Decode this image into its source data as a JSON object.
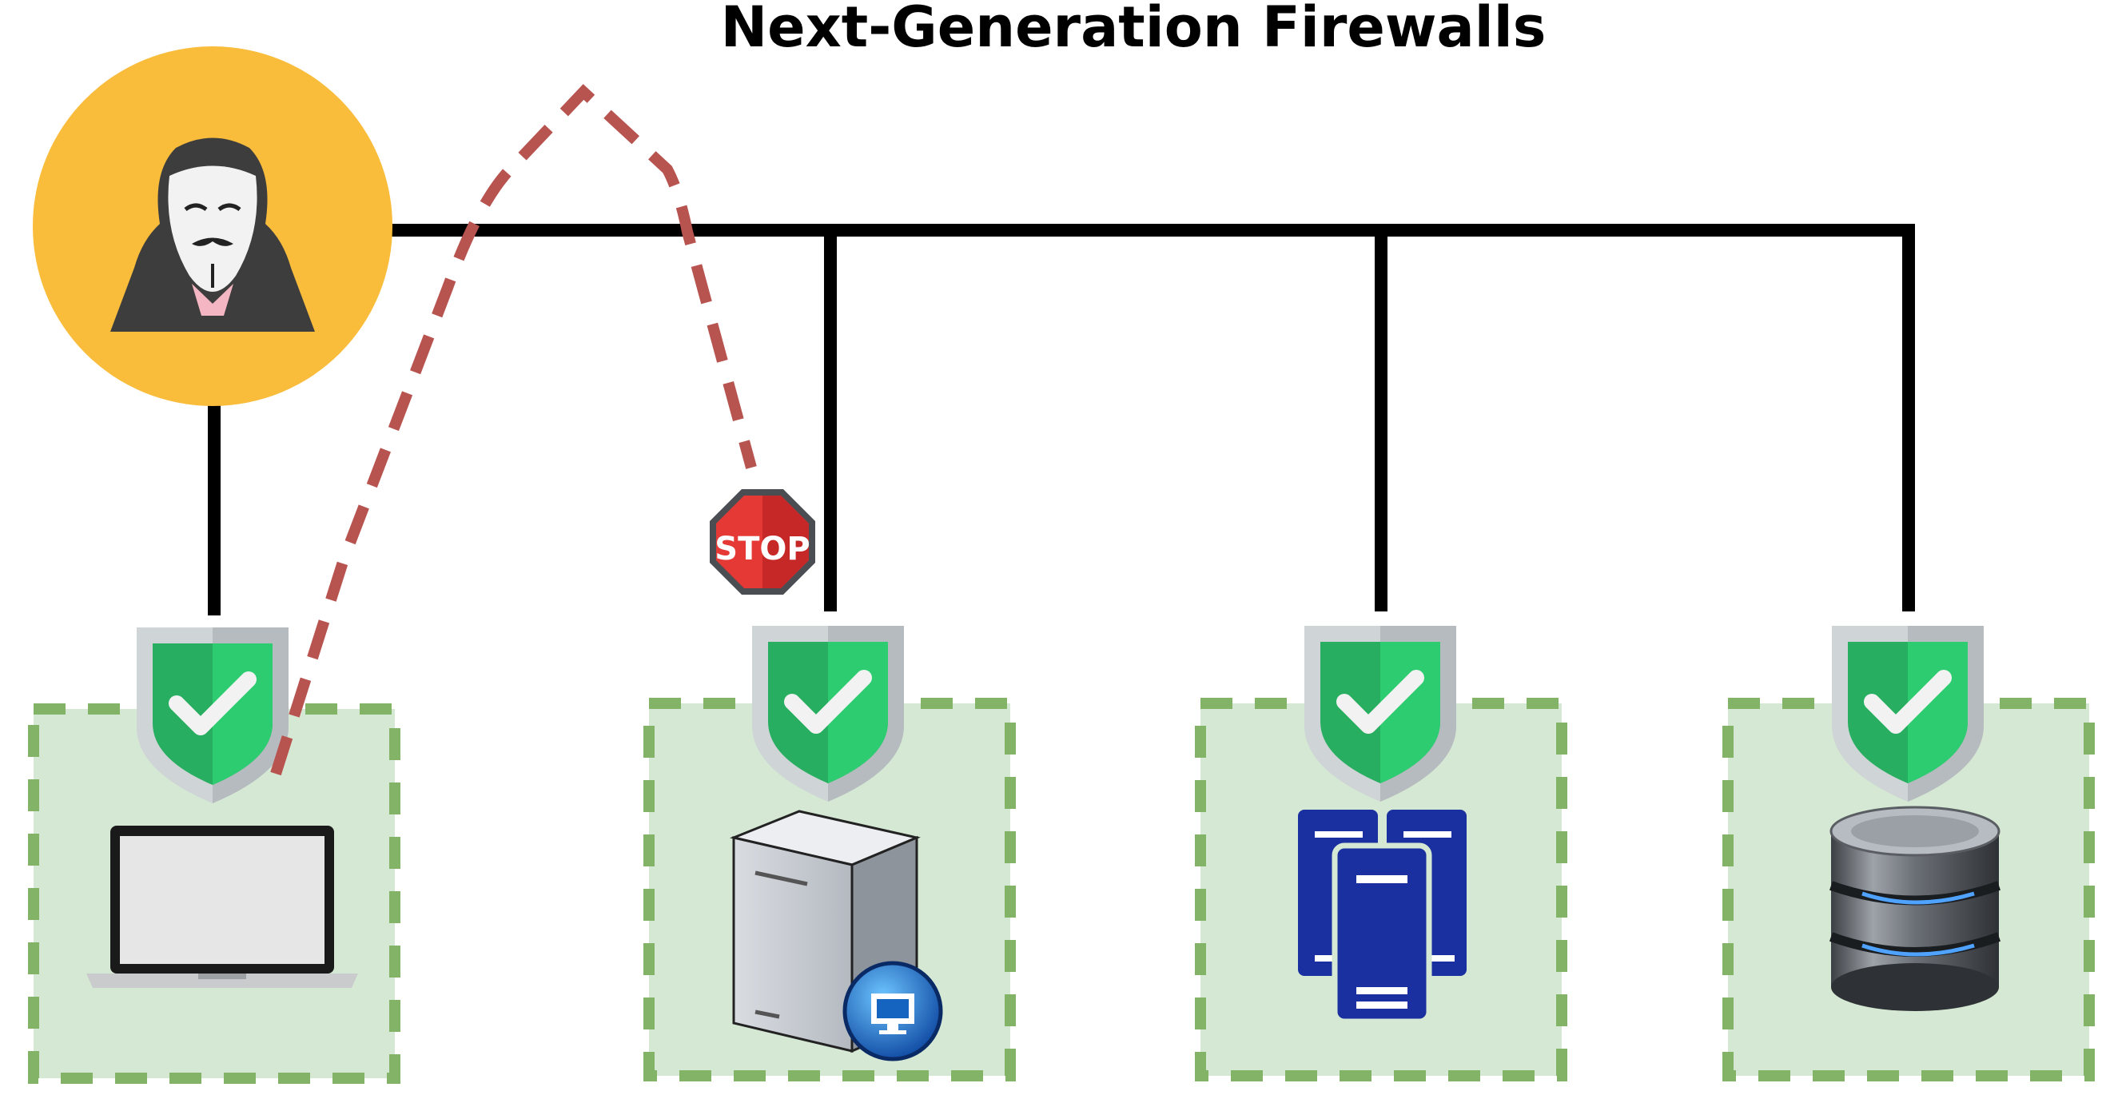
{
  "title": "Next-Generation Firewalls",
  "stop_sign": {
    "label": "STOP",
    "color": "#e53935"
  },
  "hacker": {
    "icon": "hacker-mask-icon",
    "background": "#f9bc3b"
  },
  "colors": {
    "network_line": "#000000",
    "zone_fill": "#d5e8d4",
    "zone_border": "#82b366",
    "attack_path": "#b85450",
    "shield_green": "#2ecc71",
    "shield_silver": "#cfd4d6"
  },
  "zones": [
    {
      "id": "laptop",
      "device_icon": "laptop-icon",
      "protection_icon": "shield-check-icon"
    },
    {
      "id": "server",
      "device_icon": "server-tower-icon",
      "protection_icon": "shield-check-icon"
    },
    {
      "id": "cluster",
      "device_icon": "server-cluster-icon",
      "protection_icon": "shield-check-icon"
    },
    {
      "id": "database",
      "device_icon": "database-icon",
      "protection_icon": "shield-check-icon"
    }
  ]
}
